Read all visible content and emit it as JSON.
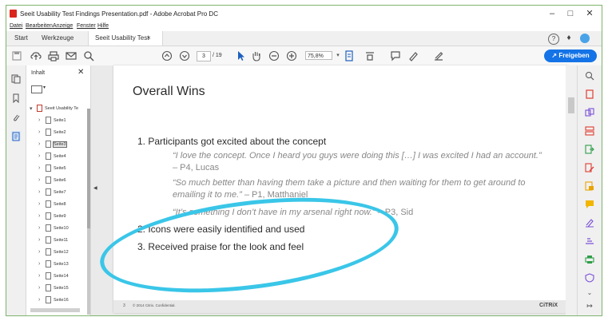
{
  "window": {
    "title": "Seeit Usability Test Findings Presentation.pdf - Adobe Acrobat Pro DC",
    "minimize": "–",
    "maximize": "□",
    "close": "✕"
  },
  "menu": [
    "Datei",
    "Bearbeiten",
    "Anzeige",
    "Fenster",
    "Hilfe"
  ],
  "tabs": {
    "start": "Start",
    "tools": "Werkzeuge",
    "document": "Seeit Usability Test ...",
    "close": "×"
  },
  "toolbar": {
    "current_page": "3",
    "total_pages": "/ 19",
    "zoom": "75,8%",
    "share_label": "Freigeben"
  },
  "navpanel": {
    "title": "Inhalt",
    "close": "✕",
    "root_label": "Seeit Usability Te",
    "pages": [
      "Seite1",
      "Seite2",
      "Seite3",
      "Seite4",
      "Seite5",
      "Seite6",
      "Seite7",
      "Seite8",
      "Seite9",
      "Seite10",
      "Seite11",
      "Seite12",
      "Seite13",
      "Seite14",
      "Seite15",
      "Seite16"
    ],
    "selected": "Seite3"
  },
  "slide": {
    "title": "Overall Wins",
    "point1": "1. Participants got excited about the concept",
    "quote1": "“I love the concept. Once I heard you guys were doing this […] I was excited I had an account.”",
    "quote1_who": " – P4, Lucas",
    "quote2": "“So much better than having them take a picture and then waiting for them to get around to emailing it to me.”",
    "quote2_who": " – P1, Matthaniel",
    "quote3": "“It’s something I don’t have in my arsenal right now.”",
    "quote3_who": " – P3, Sid",
    "point2": "2. Icons were easily identified and used",
    "point3": "3. Received praise for the look and feel",
    "footer_page": "3",
    "footer_copyright": "© 2014 Citrix. Confidential.",
    "footer_logo": "CiTRiX"
  },
  "colors": {
    "accent": "#1473e6",
    "highlight_ellipse": "#3ac6e8",
    "window_border": "#7fb36d"
  }
}
